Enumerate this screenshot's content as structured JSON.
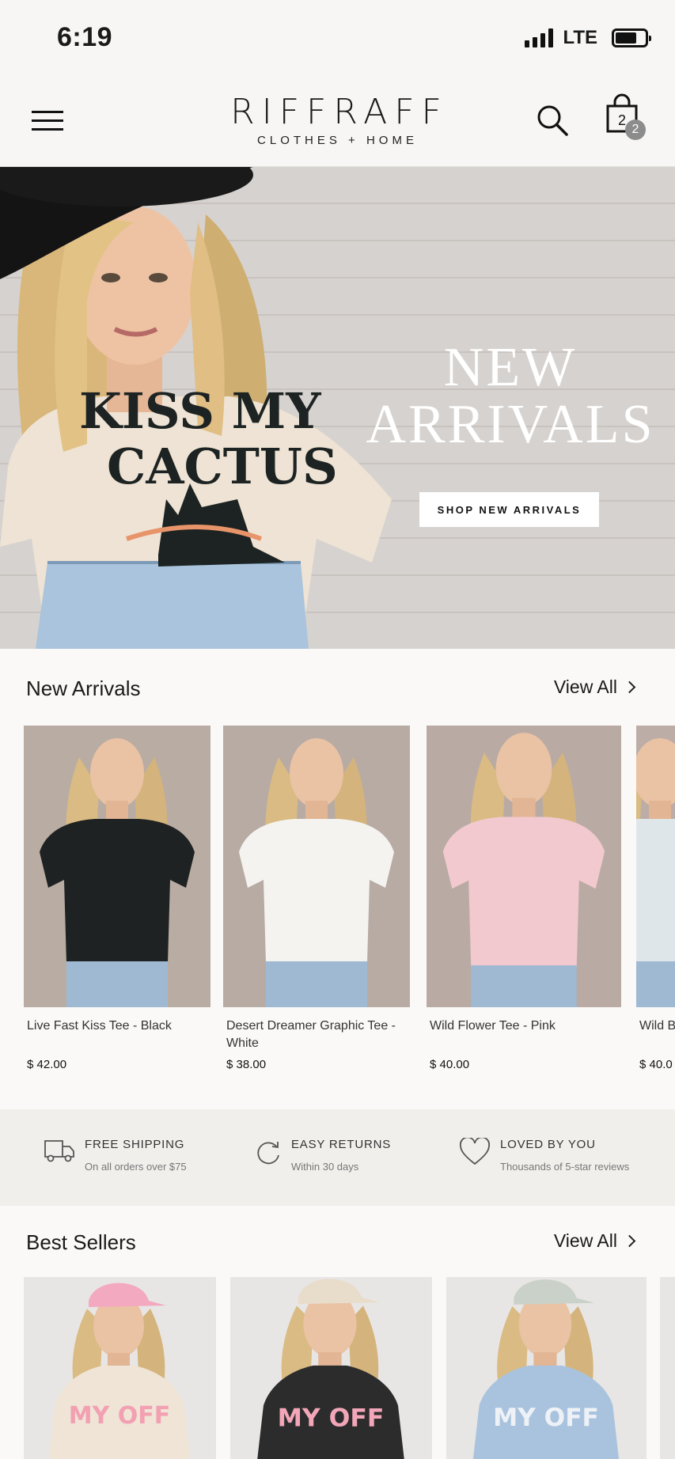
{
  "status_bar": {
    "time": "6:19",
    "network": "LTE"
  },
  "header": {
    "brand_name": "RIFFRAFF",
    "brand_sub": "CLOTHES + HOME",
    "bag_count": "2"
  },
  "hero": {
    "title_line1": "NEW",
    "title_line2": "ARRIVALS",
    "cta_label": "SHOP NEW ARRIVALS",
    "shirt_text_line1": "KISS MY",
    "shirt_text_line2": "CACTUS"
  },
  "new_arrivals": {
    "title": "New Arrivals",
    "view_all": "View All",
    "products": [
      {
        "name": "Live Fast Kiss Tee - Black",
        "price": "$ 42.00",
        "shirt_color": "#1f2222",
        "bg": "#b9aca3"
      },
      {
        "name": "Desert Dreamer Graphic Tee - White",
        "price": "$ 38.00",
        "shirt_color": "#f4f3f0",
        "bg": "#b8aba4"
      },
      {
        "name": "Wild Flower Tee - Pink",
        "price": "$ 40.00",
        "shirt_color": "#f1c9cf",
        "bg": "#b9aba4"
      },
      {
        "name": "Wild B",
        "price": "$ 40.0",
        "shirt_color": "#dfe6ea",
        "bg": "#bcaea6"
      }
    ]
  },
  "features": [
    {
      "icon": "truck-icon",
      "title": "FREE SHIPPING",
      "subtitle": "On all orders over $75"
    },
    {
      "icon": "returns-icon",
      "title": "EASY RETURNS",
      "subtitle": "Within 30 days"
    },
    {
      "icon": "heart-icon",
      "title": "LOVED BY YOU",
      "subtitle": "Thousands of 5-star reviews"
    }
  ],
  "best_sellers": {
    "title": "Best Sellers",
    "view_all": "View All",
    "products": [
      {
        "graphic": "MY OFF",
        "shirt_color": "#efe4d6",
        "hat_color": "#f3a9c0",
        "text_color": "#f2a0b2"
      },
      {
        "graphic": "MY OFF",
        "shirt_color": "#2c2c2c",
        "hat_color": "#e8dccb",
        "text_color": "#f2a6b8"
      },
      {
        "graphic": "MY OFF",
        "shirt_color": "#a9c3de",
        "hat_color": "#c9d1c8",
        "text_color": "#eef2f6"
      }
    ]
  },
  "colors": {
    "accent": "#111111",
    "badge": "#8c8c8c",
    "background": "#faf9f8"
  }
}
